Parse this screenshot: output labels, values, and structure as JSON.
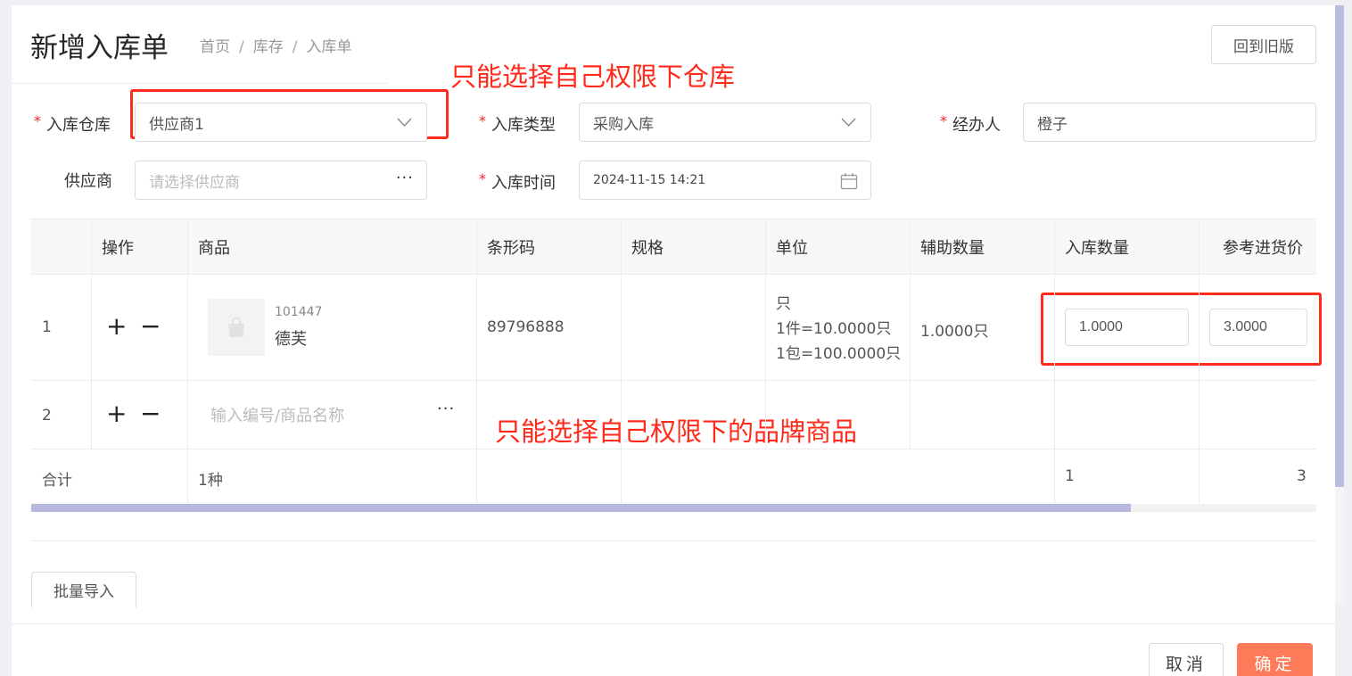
{
  "header": {
    "title": "新增入库单",
    "breadcrumb": [
      "首页",
      "库存",
      "入库单"
    ],
    "breadcrumb_sep": "/",
    "old_version_label": "回到旧版"
  },
  "annotations": {
    "warehouse_note": "只能选择自己权限下仓库",
    "product_note": "只能选择自己权限下的品牌商品"
  },
  "form": {
    "warehouse": {
      "label": "入库仓库",
      "required": true,
      "value": "供应商1"
    },
    "type": {
      "label": "入库类型",
      "required": true,
      "value": "采购入库"
    },
    "handler": {
      "label": "经办人",
      "required": true,
      "value": "橙子"
    },
    "supplier": {
      "label": "供应商",
      "required": false,
      "placeholder": "请选择供应商"
    },
    "time": {
      "label": "入库时间",
      "required": true,
      "value": "2024-11-15 14:21"
    }
  },
  "table": {
    "columns": [
      "操作",
      "商品",
      "条形码",
      "规格",
      "单位",
      "辅助数量",
      "入库数量",
      "参考进货价"
    ],
    "rows": [
      {
        "index": "1",
        "product_code": "101447",
        "product_name": "德芙",
        "barcode": "89796888",
        "spec": "",
        "unit_lines": [
          "只",
          "1件=10.0000只",
          "1包=100.0000只"
        ],
        "aux_qty": "1.0000只",
        "qty": "1.0000",
        "price": "3.0000"
      },
      {
        "index": "2",
        "product_placeholder": "输入编号/商品名称"
      }
    ],
    "total": {
      "label": "合计",
      "kinds": "1种",
      "qty": "1",
      "price": "3"
    }
  },
  "actions": {
    "import_label": "批量导入",
    "cancel_label": "取消",
    "confirm_label": "确定"
  },
  "colors": {
    "accent": "#fe7b59",
    "annotation": "#ff2a1a",
    "required": "#f5222d",
    "scrollbar": "#b6b8de"
  }
}
